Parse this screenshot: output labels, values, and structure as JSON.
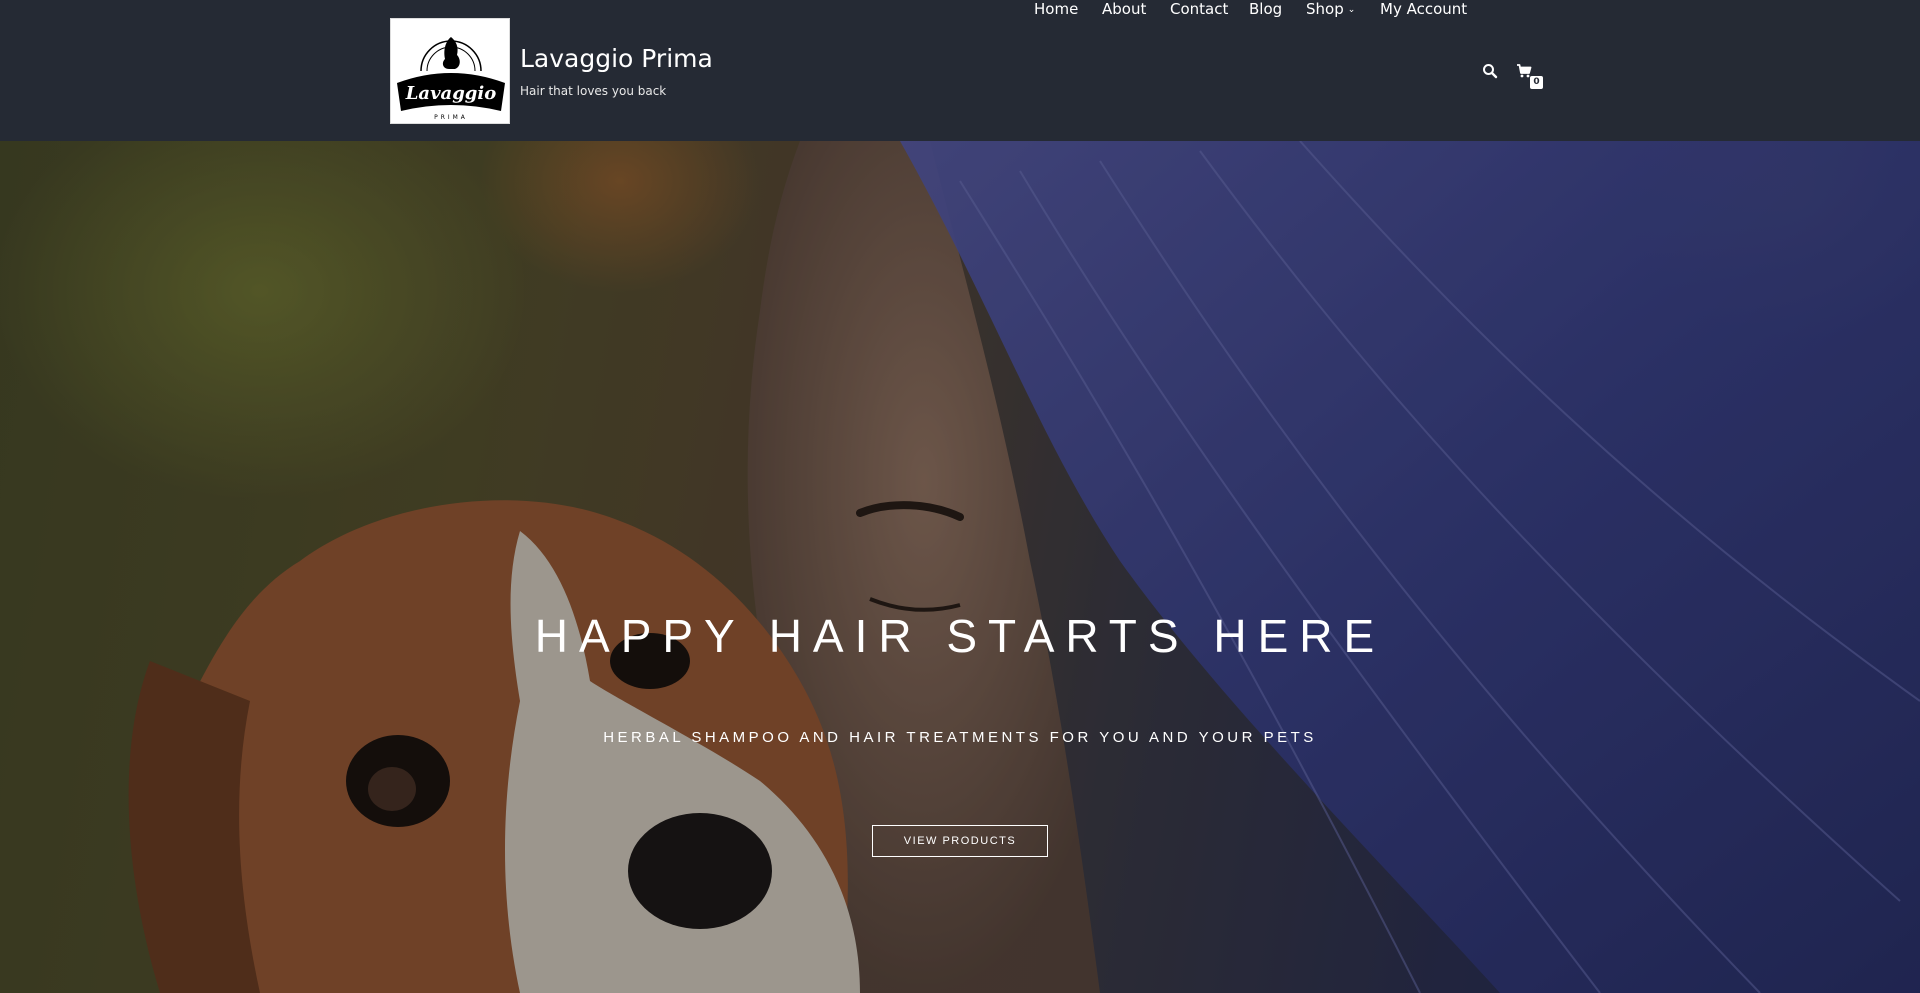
{
  "site": {
    "title": "Lavaggio Prima",
    "tagline": "Hair that loves you back",
    "logo_text": "Lavaggio",
    "logo_subtext": "PRIMA"
  },
  "nav": {
    "items": [
      {
        "label": "Home"
      },
      {
        "label": "About"
      },
      {
        "label": "Contact"
      },
      {
        "label": "Blog"
      },
      {
        "label": "Shop",
        "has_dropdown": true
      },
      {
        "label": "My Account"
      }
    ],
    "search_icon": "search-icon",
    "cart_icon": "cart-icon",
    "cart_count": "0"
  },
  "hero": {
    "title": "HAPPY HAIR STARTS HERE",
    "subtitle": "HERBAL SHAMPOO AND HAIR TREATMENTS FOR YOU AND YOUR PETS",
    "button_label": "VIEW PRODUCTS"
  },
  "colors": {
    "header_bg": "#252a34",
    "text": "#ffffff"
  }
}
